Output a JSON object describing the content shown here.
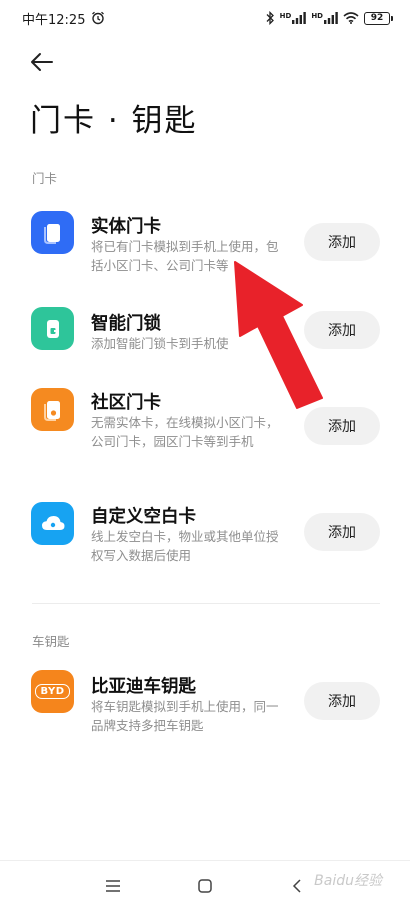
{
  "status_bar": {
    "time": "中午12:25",
    "network_badge": "HD",
    "battery": "92"
  },
  "header": {
    "title": "门卡 · 钥匙"
  },
  "sections": [
    {
      "label": "门卡",
      "items": [
        {
          "title": "实体门卡",
          "description": "将已有门卡模拟到手机上使用，包括小区门卡、公司门卡等",
          "button": "添加",
          "icon": "door-card-icon",
          "color": "#2f6cf5"
        },
        {
          "title": "智能门锁",
          "description": "添加智能门锁卡到手机使",
          "button": "添加",
          "icon": "smart-lock-icon",
          "color": "#2ec59a"
        },
        {
          "title": "社区门卡",
          "description": "无需实体卡，在线模拟小区门卡，公司门卡，园区门卡等到手机",
          "button": "添加",
          "icon": "community-card-icon",
          "color": "#f58a20"
        },
        {
          "title": "自定义空白卡",
          "description": "线上发空白卡，物业或其他单位授权写入数据后使用",
          "button": "添加",
          "icon": "cloud-card-icon",
          "color": "#17a3f2"
        }
      ]
    },
    {
      "label": "车钥匙",
      "items": [
        {
          "title": "比亚迪车钥匙",
          "description": "将车钥匙模拟到手机上使用，同一品牌支持多把车钥匙",
          "button": "添加",
          "icon": "byd-logo-icon",
          "color": "#f5851c",
          "logo_text": "BYD"
        }
      ]
    }
  ],
  "watermark": "Baidu经验"
}
